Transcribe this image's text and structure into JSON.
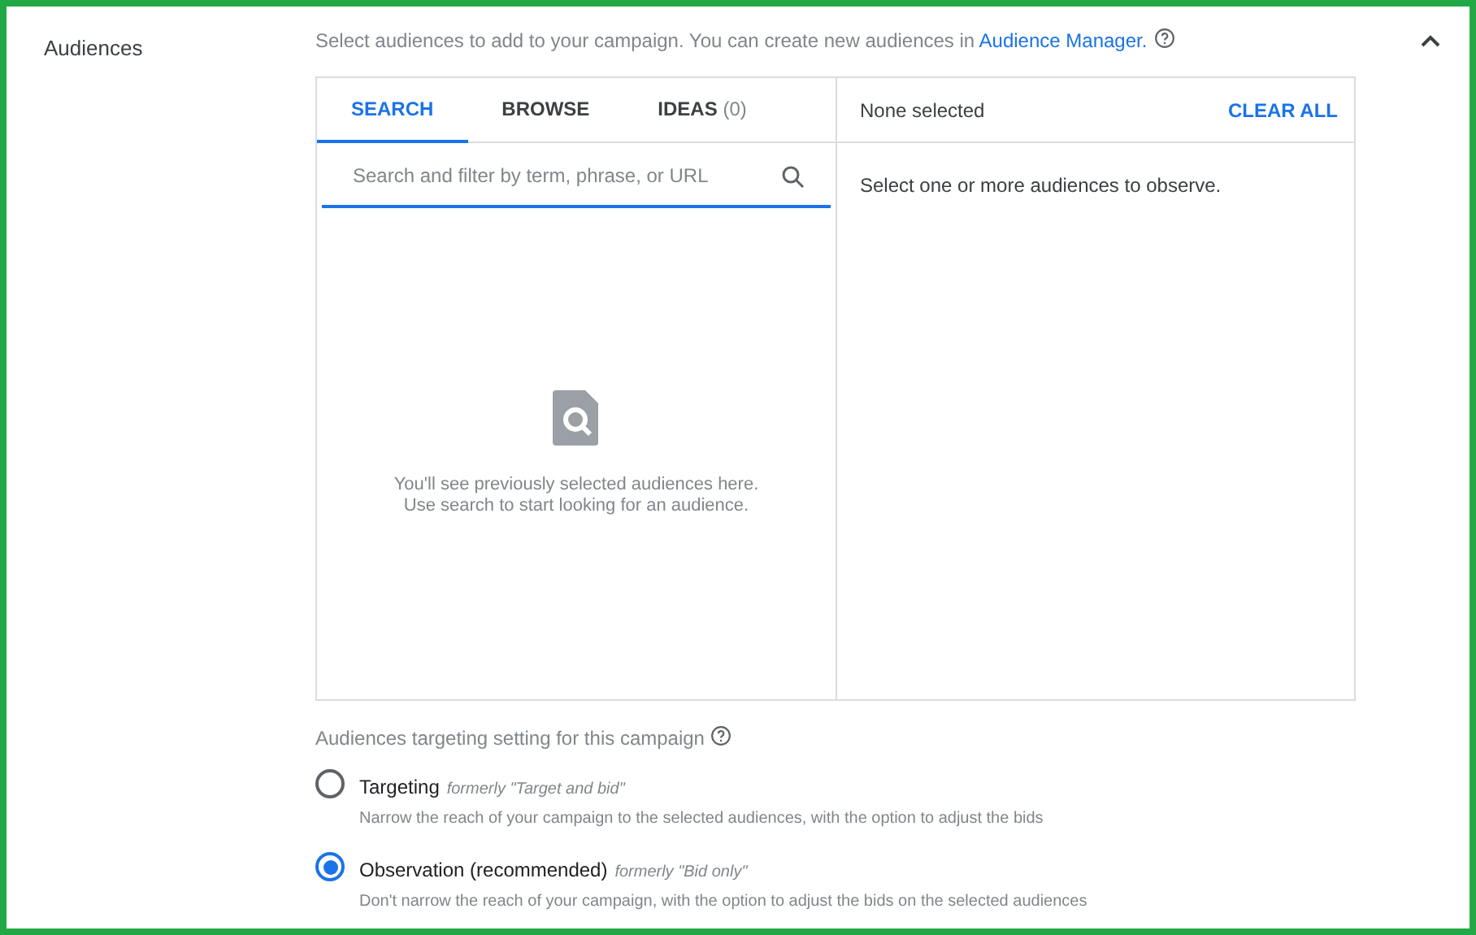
{
  "section": {
    "title": "Audiences",
    "expanded": true
  },
  "intro": {
    "text": "Select audiences to add to your campaign. You can create new audiences in",
    "link": "Audience Manager."
  },
  "tabs": [
    {
      "label": "SEARCH",
      "selected": true
    },
    {
      "label": "BROWSE",
      "selected": false
    },
    {
      "label": "IDEAS",
      "count": "(0)",
      "selected": false
    }
  ],
  "search": {
    "placeholder": "Search and filter by term, phrase, or URL"
  },
  "empty_state": {
    "lines": [
      "You'll see previously selected audiences here.",
      "Use search to start looking for an audience."
    ]
  },
  "selected_panel": {
    "status": "None selected",
    "clear_button": "CLEAR ALL",
    "message": "Select one or more audiences to observe."
  },
  "targeting": {
    "heading": "Audiences targeting setting for this campaign",
    "options": [
      {
        "label": "Targeting",
        "note": "formerly \"Target and bid\"",
        "description": "Narrow the reach of your campaign to the selected audiences, with the option to adjust the bids",
        "selected": false
      },
      {
        "label": "Observation (recommended)",
        "note": "formerly \"Bid only\"",
        "description": "Don't narrow the reach of your campaign, with the option to adjust the bids on the selected audiences",
        "selected": true
      }
    ]
  }
}
